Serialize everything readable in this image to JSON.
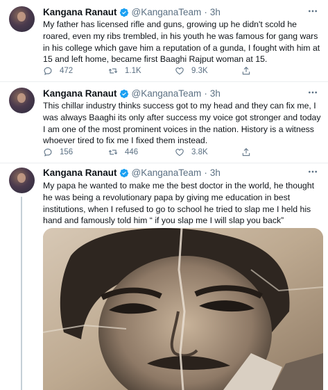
{
  "tweets": [
    {
      "name": "Kangana Ranaut",
      "handle": "@KanganaTeam",
      "separator": "·",
      "time": "3h",
      "text": "My father has licensed rifle and guns, growing up he didn't scold he roared, even my ribs trembled, in his youth he was famous for gang wars in his college which gave him a reputation of a gunda, I fought with him at 15 and left  home, became first Baaghi Rajput woman at 15.",
      "replies": "472",
      "retweets": "1.1K",
      "likes": "9.3K"
    },
    {
      "name": "Kangana Ranaut",
      "handle": "@KanganaTeam",
      "separator": "·",
      "time": "3h",
      "text": "This chillar industry thinks success got to my head and they can fix me, I was always Baaghi its only after success my voice got stronger and today I am one of the most prominent voices in the nation. History is a witness whoever tired to fix me I fixed them instead.",
      "replies": "156",
      "retweets": "446",
      "likes": "3.8K"
    },
    {
      "name": "Kangana Ranaut",
      "handle": "@KanganaTeam",
      "separator": "·",
      "time": "3h",
      "text": "My papa he wanted to make me the best doctor in the world, he thought he was being a revolutionary papa by giving me education in best institutions, when I refused to go to school he tried to slap me I held his hand and famously told him “ if you slap me I will slap you back”"
    }
  ],
  "colors": {
    "verified": "#1da1f2",
    "secondary_text": "#5b7083",
    "divider": "#ebeef0"
  },
  "icons": {
    "reply": "reply-icon",
    "retweet": "retweet-icon",
    "like": "like-icon",
    "share": "share-icon",
    "verified": "verified-badge-icon",
    "more": "more-icon"
  }
}
